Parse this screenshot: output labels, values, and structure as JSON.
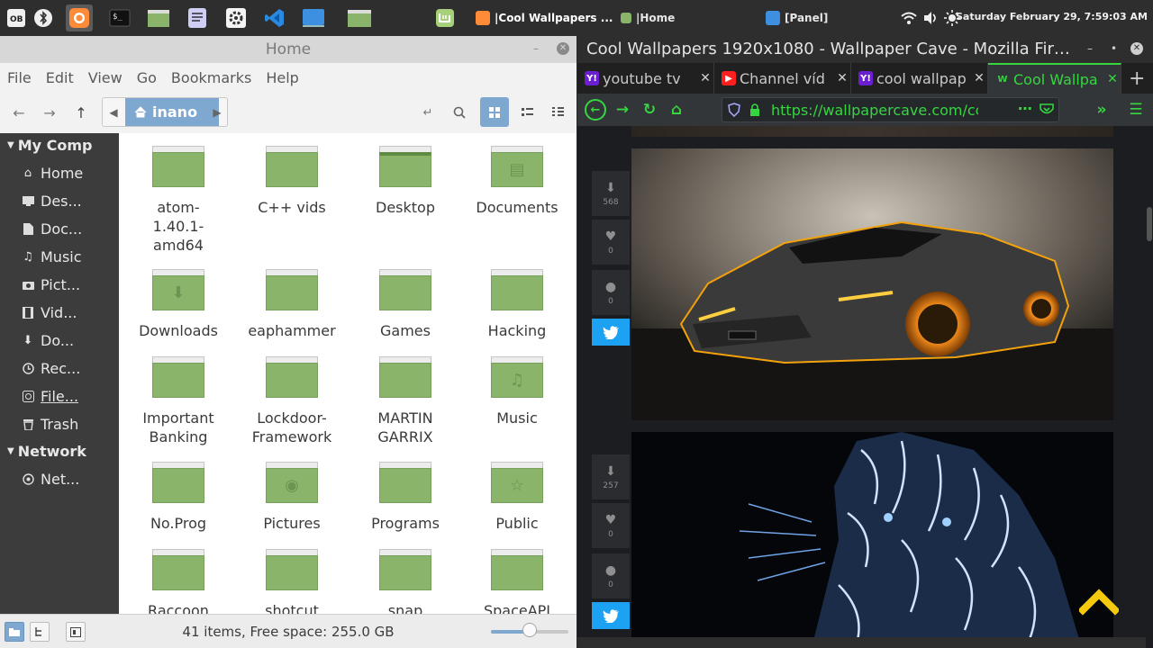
{
  "panel": {
    "clock": "Saturday February 29, 7:59:03 AM",
    "tasks": [
      {
        "label": "|Cool Wallpapers ..."
      },
      {
        "label": "|Home"
      },
      {
        "label": "[Panel]"
      }
    ],
    "tray_icons": [
      "wifi-icon",
      "volume-icon",
      "brightness-icon"
    ]
  },
  "nemo": {
    "title": "Home",
    "menu": [
      "File",
      "Edit",
      "View",
      "Go",
      "Bookmarks",
      "Help"
    ],
    "breadcrumb": "inano",
    "sidebar": {
      "sections": [
        {
          "title": "My Comp",
          "items": [
            {
              "label": "Home",
              "icon": "home-icon"
            },
            {
              "label": "Des...",
              "icon": "desktop-icon"
            },
            {
              "label": "Doc...",
              "icon": "document-icon"
            },
            {
              "label": "Music",
              "icon": "music-icon"
            },
            {
              "label": "Pict...",
              "icon": "picture-icon"
            },
            {
              "label": "Vid...",
              "icon": "video-icon"
            },
            {
              "label": "Do...",
              "icon": "download-icon"
            },
            {
              "label": "Rec...",
              "icon": "recent-icon"
            },
            {
              "label": "File...",
              "icon": "filesystem-icon"
            },
            {
              "label": "Trash",
              "icon": "trash-icon"
            }
          ]
        },
        {
          "title": "Network",
          "items": [
            {
              "label": "Net...",
              "icon": "network-icon"
            }
          ]
        }
      ]
    },
    "folders": [
      {
        "name": "atom-\n1.40.1-\namd64",
        "emblem": ""
      },
      {
        "name": "C++ vids",
        "emblem": ""
      },
      {
        "name": "Desktop",
        "emblem": "desktop"
      },
      {
        "name": "Documents",
        "emblem": "document"
      },
      {
        "name": "Downloads",
        "emblem": "download"
      },
      {
        "name": "eaphammer",
        "emblem": ""
      },
      {
        "name": "Games",
        "emblem": ""
      },
      {
        "name": "Hacking",
        "emblem": ""
      },
      {
        "name": "Important\nBanking",
        "emblem": ""
      },
      {
        "name": "Lockdoor-\nFramework",
        "emblem": ""
      },
      {
        "name": "MARTIN\nGARRIX",
        "emblem": ""
      },
      {
        "name": "Music",
        "emblem": "music"
      },
      {
        "name": "No.Prog",
        "emblem": ""
      },
      {
        "name": "Pictures",
        "emblem": "camera"
      },
      {
        "name": "Programs",
        "emblem": ""
      },
      {
        "name": "Public",
        "emblem": "share"
      },
      {
        "name": "Raccoon",
        "emblem": ""
      },
      {
        "name": "shotcut",
        "emblem": ""
      },
      {
        "name": "snap",
        "emblem": ""
      },
      {
        "name": "SpaceAPI",
        "emblem": ""
      }
    ],
    "status": "41 items, Free space: 255.0 GB",
    "zoom_level": 0.5
  },
  "firefox": {
    "title": "Cool Wallpapers 1920x1080 - Wallpaper Cave - Mozilla Fir…",
    "tabs": [
      {
        "label": "youtube tv",
        "favicon": "Y!",
        "fav_color": "#6b1fd1",
        "active": false
      },
      {
        "label": "Channel víd",
        "favicon": "▶",
        "fav_color": "#ff1f1f",
        "active": false
      },
      {
        "label": "cool wallpap",
        "favicon": "Y!",
        "fav_color": "#6b1fd1",
        "active": false
      },
      {
        "label": "Cool Wallpa",
        "favicon": "W",
        "fav_color": "#323639",
        "active": true
      }
    ],
    "url": "https://wallpapercave.com/cc",
    "wallpapers": [
      {
        "name": "lamborghini",
        "downloads": "568",
        "likes": "0",
        "comments": "0"
      },
      {
        "name": "tiger",
        "downloads": "257",
        "likes": "0",
        "comments": "0"
      }
    ],
    "accent": "#35d63f"
  }
}
